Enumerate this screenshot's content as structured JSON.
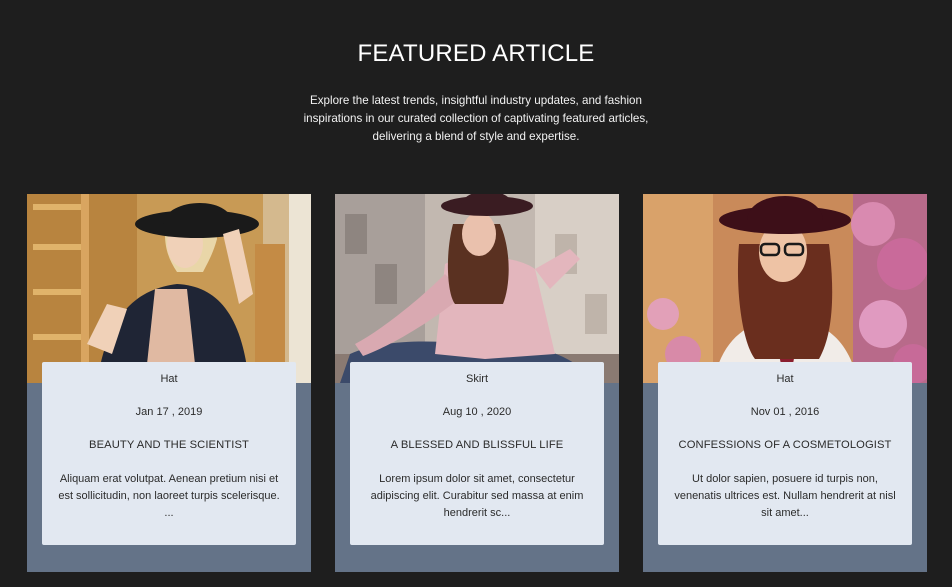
{
  "section": {
    "title": "FEATURED ARTICLE",
    "intro": "Explore the latest trends, insightful industry updates, and fashion inspirations in our curated collection of captivating featured articles, delivering a blend of style and expertise."
  },
  "articles": [
    {
      "category": "Hat",
      "date": "Jan 17 , 2019",
      "title": "BEAUTY AND THE SCIENTIST",
      "excerpt": "Aliquam erat volutpat. Aenean pretium nisi et est sollicitudin, non laoreet turpis scelerisque. ..."
    },
    {
      "category": "Skirt",
      "date": "Aug 10 , 2020",
      "title": "A BLESSED AND BLISSFUL LIFE",
      "excerpt": "Lorem ipsum dolor sit amet, consectetur adipiscing elit. Curabitur sed massa at enim hendrerit sc..."
    },
    {
      "category": "Hat",
      "date": "Nov 01 , 2016",
      "title": "CONFESSIONS OF A COSMETOLOGIST",
      "excerpt": "Ut dolor sapien, posuere id turpis non, venenatis ultrices est. Nullam hendrerit at nisl sit amet..."
    }
  ],
  "colors": {
    "page_background": "#1e1e1e",
    "card_background": "#647388",
    "panel_background": "#e2e8f1"
  }
}
